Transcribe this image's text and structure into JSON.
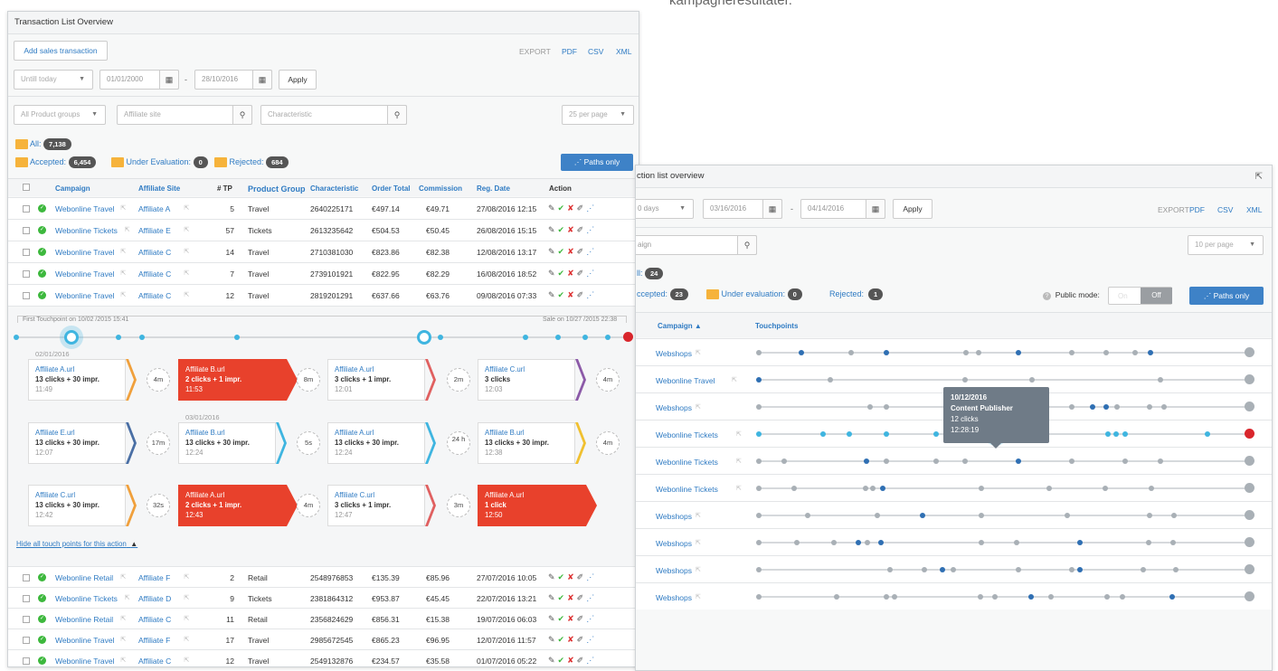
{
  "hero_text": "kampagneresultater.",
  "p1": {
    "title": "Transaction List Overview",
    "add_label": "Add sales transaction",
    "export": "EXPORT",
    "pdf": "PDF",
    "csv": "CSV",
    "xml": "XML",
    "period": "Untill today",
    "date_from": "01/01/2000",
    "date_to": "28/10/2016",
    "dash": "-",
    "apply": "Apply",
    "product_groups": "All Product groups",
    "affiliate_ph": "Affiliate site",
    "char_ph": "Characteristic",
    "per_page": "25 per page",
    "all_label": "All:",
    "all_count": "7,138",
    "accepted_label": "Accepted:",
    "accepted_count": "6,454",
    "eval_label": "Under Evaluation:",
    "eval_count": "0",
    "rejected_label": "Rejected:",
    "rejected_count": "684",
    "paths_only": "Paths only",
    "headers": [
      "Campaign",
      "Affiliate Site",
      "# TP",
      "Product Group",
      "Characteristic",
      "Order Total",
      "Commission",
      "Reg. Date",
      "Action"
    ],
    "rows_top": [
      [
        "Webonline Travel",
        "Affiliate A",
        "5",
        "Travel",
        "2640225171",
        "€497.14",
        "€49.71",
        "27/08/2016 12:15"
      ],
      [
        "Webonline Tickets",
        "Affiliate E",
        "57",
        "Tickets",
        "2613235642",
        "€504.53",
        "€50.45",
        "26/08/2016 15:15"
      ],
      [
        "Webonline Travel",
        "Affiliate C",
        "14",
        "Travel",
        "2710381030",
        "€823.86",
        "€82.38",
        "12/08/2016 13:17"
      ],
      [
        "Webonline Travel",
        "Affiliate C",
        "7",
        "Travel",
        "2739101921",
        "€822.95",
        "€82.29",
        "16/08/2016 18:52"
      ],
      [
        "Webonline Travel",
        "Affiliate C",
        "12",
        "Travel",
        "2819201291",
        "€637.66",
        "€63.76",
        "09/08/2016 07:33"
      ]
    ],
    "first_tp": "First Touchpoint on 10/02 /2015 15:41",
    "sale_on": "Sale on 10/27 /2015 22:38",
    "date_a": "02/01/2016",
    "date_b": "03/01/2016",
    "tp_rows": [
      [
        [
          "Affiliate A.url",
          "13 clicks + 30 impr.",
          "11:49"
        ],
        [
          "Affiliate B.url",
          "2 clicks + 1 impr.",
          "11:53"
        ],
        [
          "Affiliate A.url",
          "3 clicks + 1 impr.",
          "12:01"
        ],
        [
          "Affiliate C.url",
          "3 clicks",
          "12:03"
        ]
      ],
      [
        [
          "Affiliate E.url",
          "13 clicks + 30 impr.",
          "12:07"
        ],
        [
          "Affiliate B.url",
          "13 clicks + 30 impr.",
          "12:24"
        ],
        [
          "Affiliate A.url",
          "13 clicks + 30 impr.",
          "12:24"
        ],
        [
          "Affiliate B.url",
          "13 clicks + 30 impr.",
          "12:38"
        ]
      ],
      [
        [
          "Affiliate C.url",
          "13 clicks + 30 impr.",
          "12:42"
        ],
        [
          "Affiliate A.url",
          "2 clicks + 1 impr.",
          "12:43"
        ],
        [
          "Affiliate C.url",
          "3 clicks + 1 impr.",
          "12:47"
        ],
        [
          "Affiliate A.url",
          "1 click",
          "12:50"
        ]
      ]
    ],
    "durs": [
      [
        "4m",
        "8m",
        "2m",
        "4m"
      ],
      [
        "17m",
        "5s",
        "24 h",
        "4m"
      ],
      [
        "32s",
        "4m",
        "3m"
      ]
    ],
    "hide_link": "Hide all touch points for this action",
    "rows_bottom": [
      [
        "Webonline Retail",
        "Affiliate F",
        "2",
        "Retail",
        "2548976853",
        "€135.39",
        "€85.96",
        "27/07/2016 10:05"
      ],
      [
        "Webonline Tickets",
        "Affiliate D",
        "9",
        "Tickets",
        "2381864312",
        "€953.87",
        "€45.45",
        "22/07/2016 13:21"
      ],
      [
        "Webonline Retail",
        "Affiliate C",
        "11",
        "Retail",
        "2356824629",
        "€856.31",
        "€15.38",
        "19/07/2016 06:03"
      ],
      [
        "Webonline Travel",
        "Affiliate F",
        "17",
        "Travel",
        "2985672545",
        "€865.23",
        "€96.95",
        "12/07/2016 11:57"
      ],
      [
        "Webonline Travel",
        "Affiliate C",
        "12",
        "Travel",
        "2549132876",
        "€234.57",
        "€35.58",
        "01/07/2016 05:22"
      ]
    ]
  },
  "p2": {
    "title": "ction list overview",
    "period": "0 days",
    "date_from": "03/16/2016",
    "date_to": "04/14/2016",
    "dash": "-",
    "apply": "Apply",
    "export": "EXPORT",
    "pdf": "PDF",
    "csv": "CSV",
    "xml": "XML",
    "search_ph": "aign",
    "per_page": "10 per page",
    "all_label": "ll:",
    "all_count": "24",
    "accepted_label": "ccepted:",
    "accepted_count": "23",
    "eval_label": "Under evaluation:",
    "eval_count": "0",
    "rejected_label": "Rejected:",
    "rejected_count": "1",
    "public_mode": "Public mode:",
    "on": "On",
    "off": "Off",
    "paths_only": "Paths only",
    "col_campaign": "Campaign ▲",
    "col_tp": "Touchpoints",
    "rows": [
      "Webshops",
      "Webonline Travel",
      "Webshops",
      "Webonline Tickets",
      "Webonline Tickets",
      "Webonline Tickets",
      "Webshops",
      "Webshops",
      "Webshops",
      "Webshops"
    ],
    "tooltip": {
      "date": "10/12/2016",
      "name": "Content Publisher",
      "clicks": "12 clicks",
      "time": "12:28:19"
    }
  }
}
